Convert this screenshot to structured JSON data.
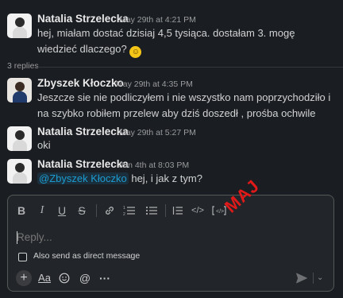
{
  "messages": [
    {
      "author": "Natalia Strzelecka",
      "time": "May 29th at 4:21 PM",
      "text": "hej, miałam dostać dzisiaj 4,5 tysiąca. dostałam 3. mogę wiedzieć dlaczego?",
      "emoji": "smiling-face"
    },
    {
      "author": "Zbyszek Kłoczko",
      "time": "May 29th at 4:35 PM",
      "text": "Jeszcze sie nie podliczyłem i nie wszystko nam poprzychodziło i na szybko robiłem przelew aby dziś doszedł , prośba ochwile"
    },
    {
      "author": "Natalia Strzelecka",
      "time": "May 29th at 5:27 PM",
      "text": "oki"
    },
    {
      "author": "Natalia Strzelecka",
      "time": "Jun 4th at 8:03 PM",
      "mention": "@Zbyszek Kłoczko",
      "text": " hej, i jak z tym?"
    }
  ],
  "replies_label": "3 replies",
  "composer": {
    "placeholder": "Reply...",
    "checkbox_label": "Also send as direct message",
    "format_label": "Aa"
  },
  "watermark": "MAJ",
  "colors": {
    "background": "#1a1d21",
    "mention": "#1d9bd1",
    "watermark": "#e01919"
  }
}
